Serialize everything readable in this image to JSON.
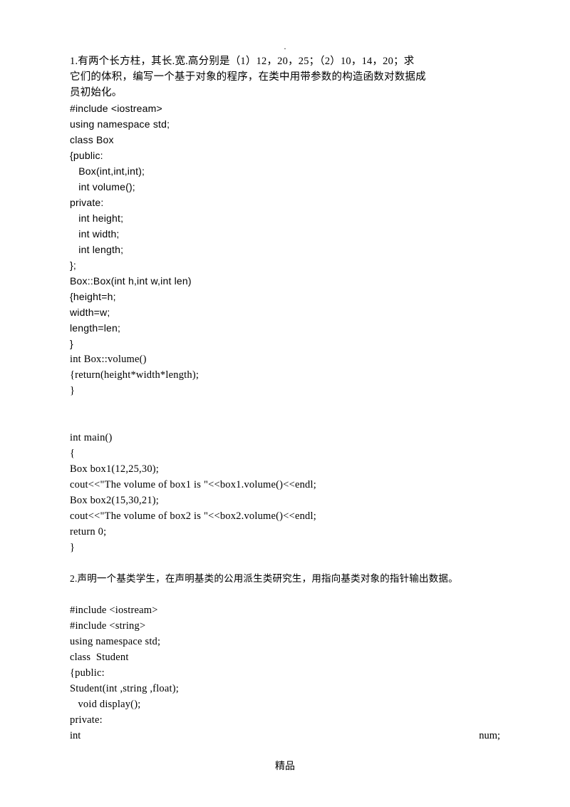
{
  "topDot": ".",
  "q1": {
    "p1": "1.有两个长方柱，其长.宽.高分别是（1）12，20，25；（2）10，14，20；求",
    "p2": "它们的体积，编写一个基于对象的程序，在类中用带参数的构造函数对数据成",
    "p3": "员初始化。",
    "c1": "#include <iostream>",
    "c2": "using namespace std;",
    "c3": "class Box",
    "c4": "{public:",
    "c5": "   Box(int,int,int);",
    "c6": "   int volume();",
    "c7": "private:",
    "c8": "   int height;",
    "c9": "   int width;",
    "c10": "   int length;",
    "c11": "};",
    "c12": "Box::Box(int h,int w,int len)",
    "c13": "{height=h;",
    "c14": "width=w;",
    "c15": "length=len;",
    "c16": "}",
    "c17": "int Box::volume()",
    "c18": "{return(height*width*length);",
    "c19": "}",
    "c20": "int main()",
    "c21": "{",
    "c22": "Box box1(12,25,30);",
    "c23": "cout<<\"The volume of box1 is \"<<box1.volume()<<endl;",
    "c24": "Box box2(15,30,21);",
    "c25": "cout<<\"The volume of box2 is \"<<box2.volume()<<endl;",
    "c26": "return 0;",
    "c27": "}"
  },
  "q2": {
    "p1": "2.声明一个基类学生，在声明基类的公用派生类研究生，用指向基类对象的指针输出数据。",
    "c1": "#include <iostream>",
    "c2": "#include <string>",
    "c3": "using namespace std;",
    "c4": "class  Student",
    "c5": "{public:",
    "c6": "Student(int ,string ,float);",
    "c7": "   void display();",
    "c8": "private:",
    "c9a": "    int",
    "c9b": "num;"
  },
  "footer": "精品"
}
